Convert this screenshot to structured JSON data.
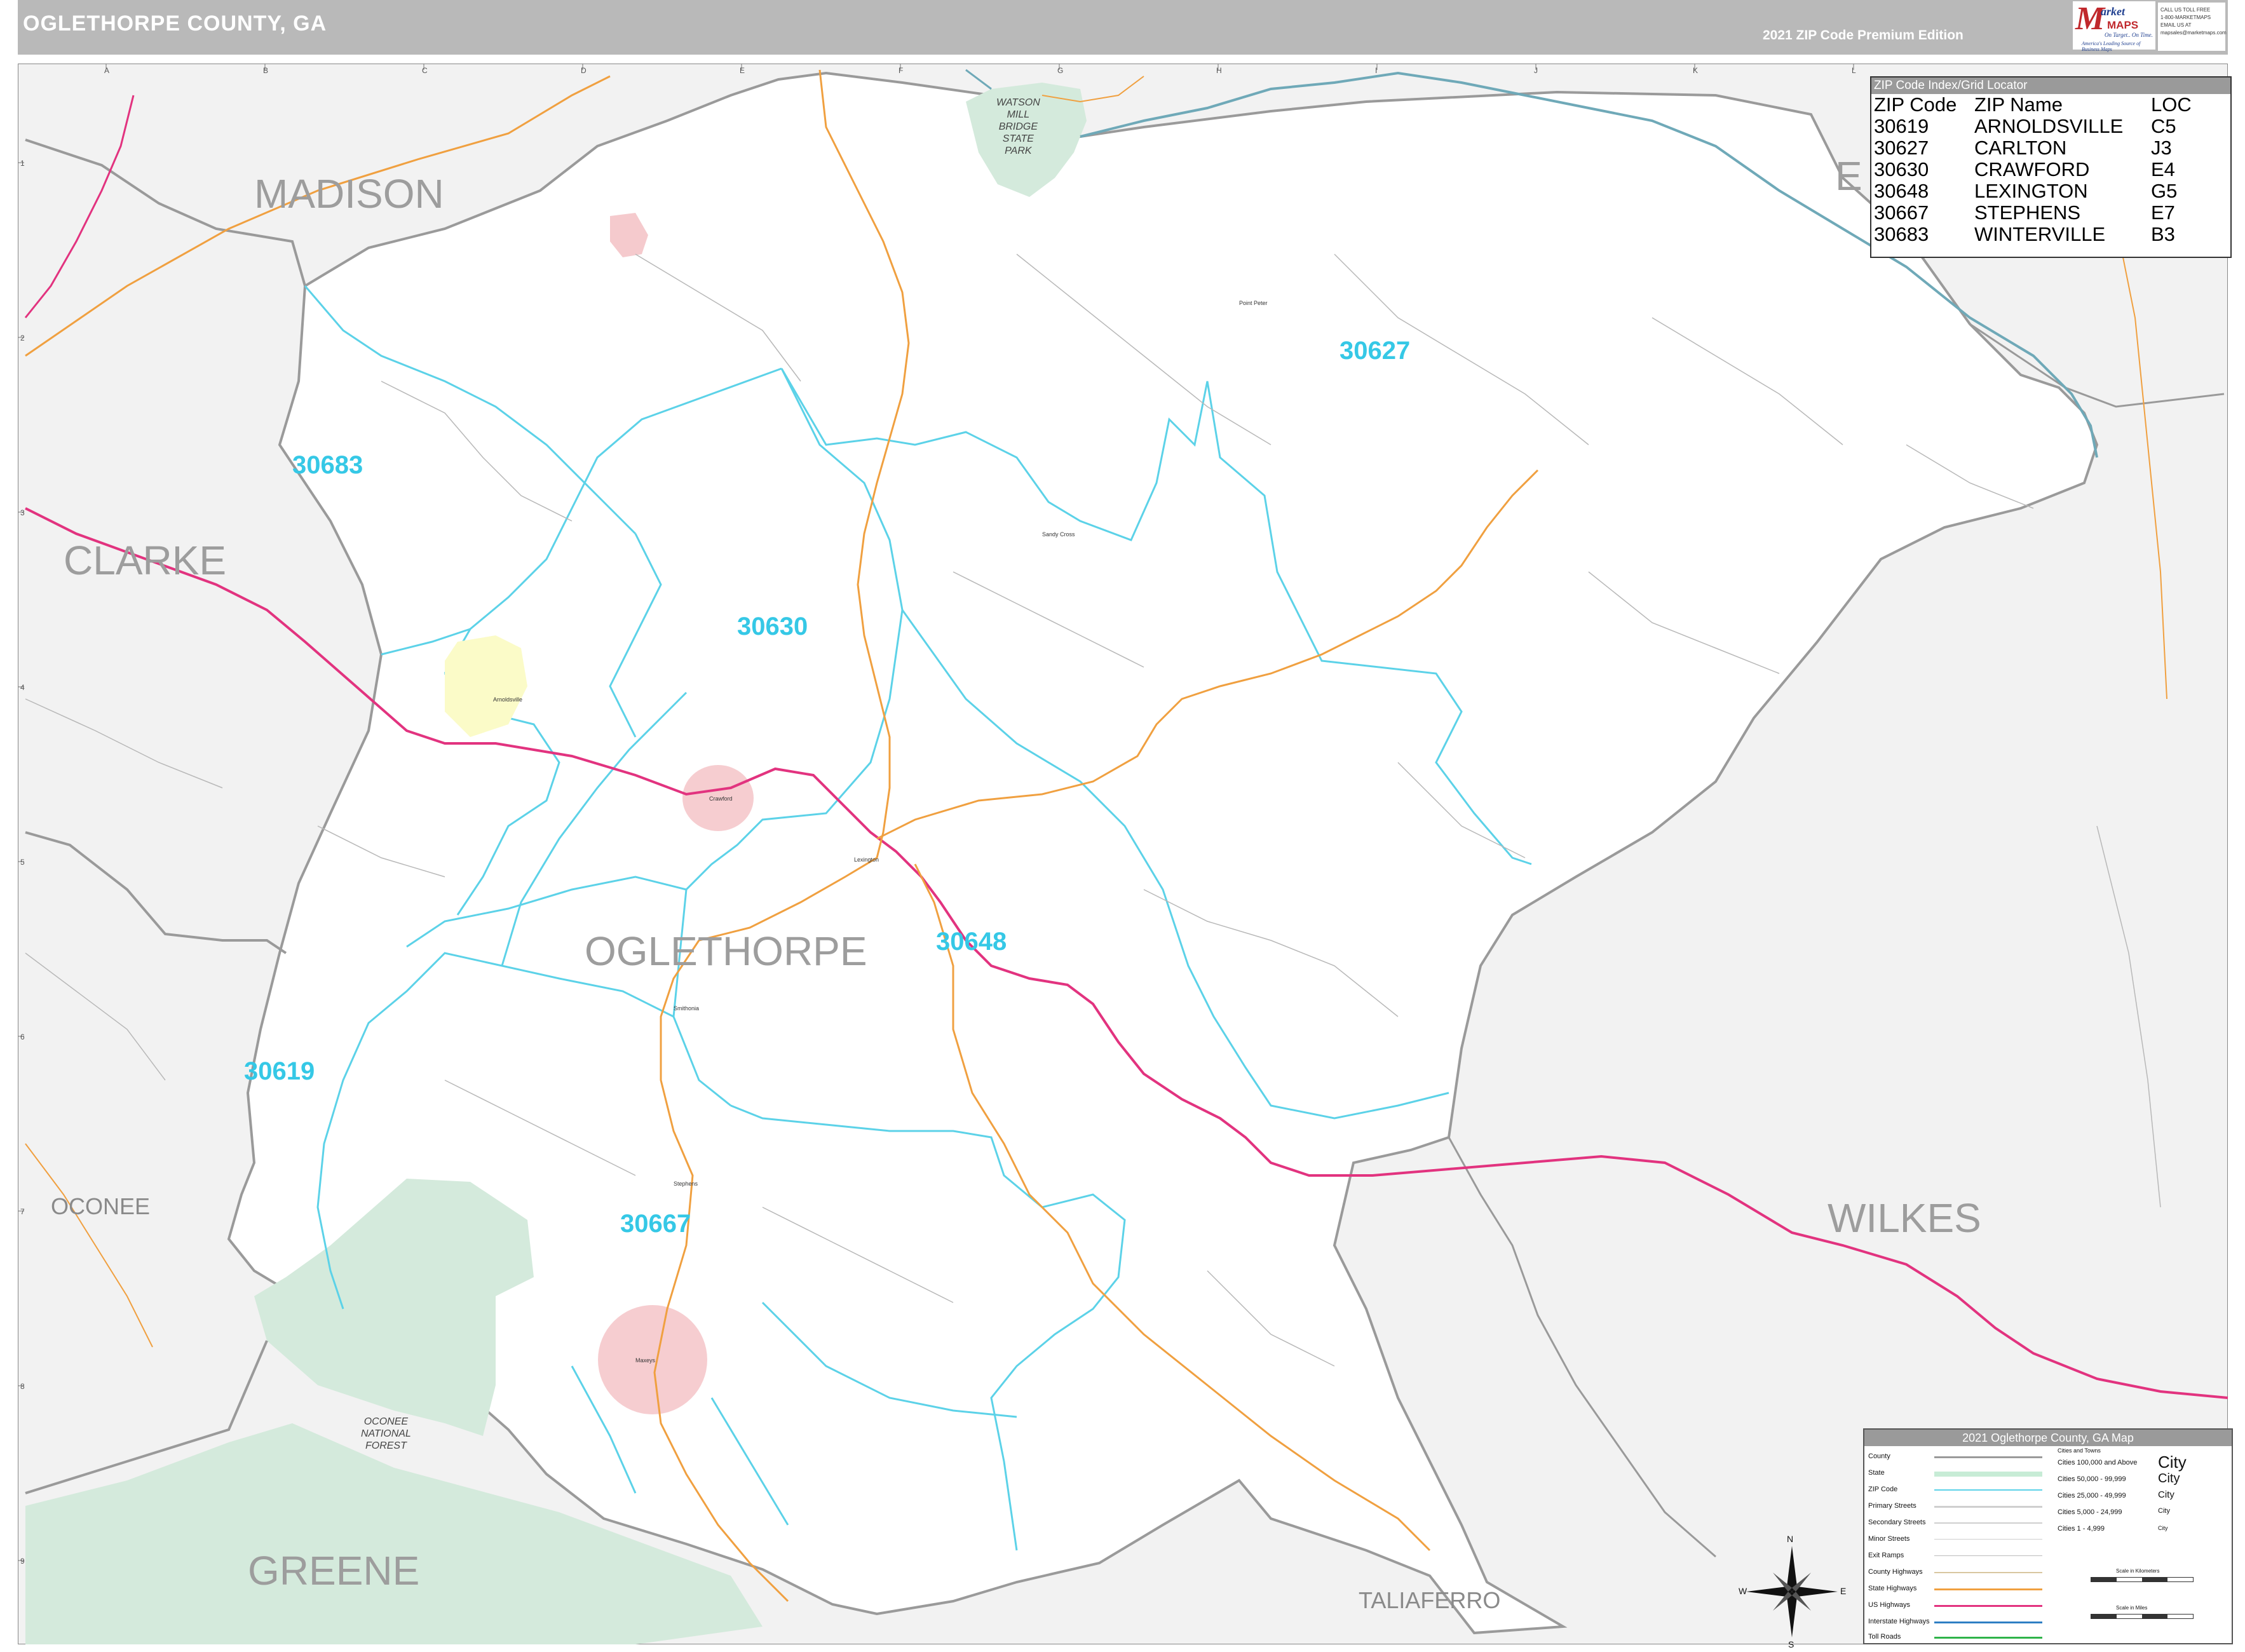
{
  "header": {
    "title": "OGLETHORPE COUNTY, GA",
    "edition": "2021 ZIP Code Premium Edition"
  },
  "logo": {
    "brand_m": "M",
    "brand_word1": "arket",
    "brand_word2": "MAPS",
    "tagline": "On Target.. On Time.",
    "subtagline": "America's Leading Source of Business Maps"
  },
  "contact": {
    "line1": "CALL US TOLL FREE",
    "line2": "1-800-MARKETMAPS",
    "line3": "EMAIL US AT",
    "line4": "mapsales@marketmaps.com"
  },
  "grid": {
    "columns": [
      "A",
      "B",
      "C",
      "D",
      "E",
      "F",
      "G",
      "H",
      "I",
      "J",
      "K",
      "L"
    ],
    "rows": [
      "1",
      "2",
      "3",
      "4",
      "5",
      "6",
      "7",
      "8",
      "9"
    ]
  },
  "counties": {
    "madison": "MADISON",
    "clarke": "CLARKE",
    "oglethorpe": "OGLETHORPE",
    "oconee": "OCONEE",
    "greene": "GREENE",
    "wilkes": "WILKES",
    "taliaferro": "TALIAFERRO",
    "elbert_partial": "E"
  },
  "zip_labels": {
    "z30627": "30627",
    "z30683": "30683",
    "z30630": "30630",
    "z30648": "30648",
    "z30619": "30619",
    "z30667": "30667"
  },
  "poi": {
    "watson_mill": [
      "WATSON",
      "MILL",
      "BRIDGE",
      "STATE",
      "PARK"
    ],
    "oconee_forest": [
      "OCONEE",
      "NATIONAL",
      "FOREST"
    ]
  },
  "towns": {
    "arnoldsville": "Arnoldsville",
    "crawford": "Crawford",
    "lexington": "Lexington",
    "stephens": "Stephens",
    "maxeys": "Maxeys",
    "sandy_cross": "Sandy Cross",
    "point_peter": "Point Peter",
    "smithonia": "Smithonia"
  },
  "zip_index": {
    "header": "ZIP Code Index/Grid Locator",
    "columns": [
      "ZIP Code",
      "ZIP Name",
      "LOC"
    ],
    "rows": [
      [
        "30619",
        "ARNOLDSVILLE",
        "C5"
      ],
      [
        "30627",
        "CARLTON",
        "J3"
      ],
      [
        "30630",
        "CRAWFORD",
        "E4"
      ],
      [
        "30648",
        "LEXINGTON",
        "G5"
      ],
      [
        "30667",
        "STEPHENS",
        "E7"
      ],
      [
        "30683",
        "WINTERVILLE",
        "B3"
      ]
    ]
  },
  "legend": {
    "header": "2021 Oglethorpe County, GA Map",
    "items": [
      "County",
      "State",
      "ZIP Code",
      "Primary Streets",
      "Secondary Streets",
      "Minor Streets",
      "Exit Ramps",
      "County Highways",
      "State Highways",
      "US Highways",
      "Interstate Highways",
      "Toll Roads"
    ],
    "cities_header": "Cities and Towns",
    "city_sizes": [
      "Cities 100,000 and Above",
      "Cities 50,000 - 99,999",
      "Cities 25,000 - 49,999",
      "Cities 5,000 - 24,999",
      "Cities 1 - 4,999"
    ],
    "city_marks": [
      "City",
      "City",
      "City",
      "City",
      "City"
    ],
    "scale_km": "Scale in Kilometers",
    "scale_mi": "Scale in Miles"
  },
  "compass": {
    "n": "N",
    "s": "S",
    "e": "E",
    "w": "W"
  },
  "colors": {
    "county_border": "#9a9a9a",
    "zip_border": "#5cd2e8",
    "state_park": "#cfe9da",
    "us_highway": "#e2337f",
    "state_highway": "#f0a040",
    "water": "#4bb8d8",
    "city_fill": "#f4c4c8",
    "town_fill": "#fbfbc8"
  }
}
